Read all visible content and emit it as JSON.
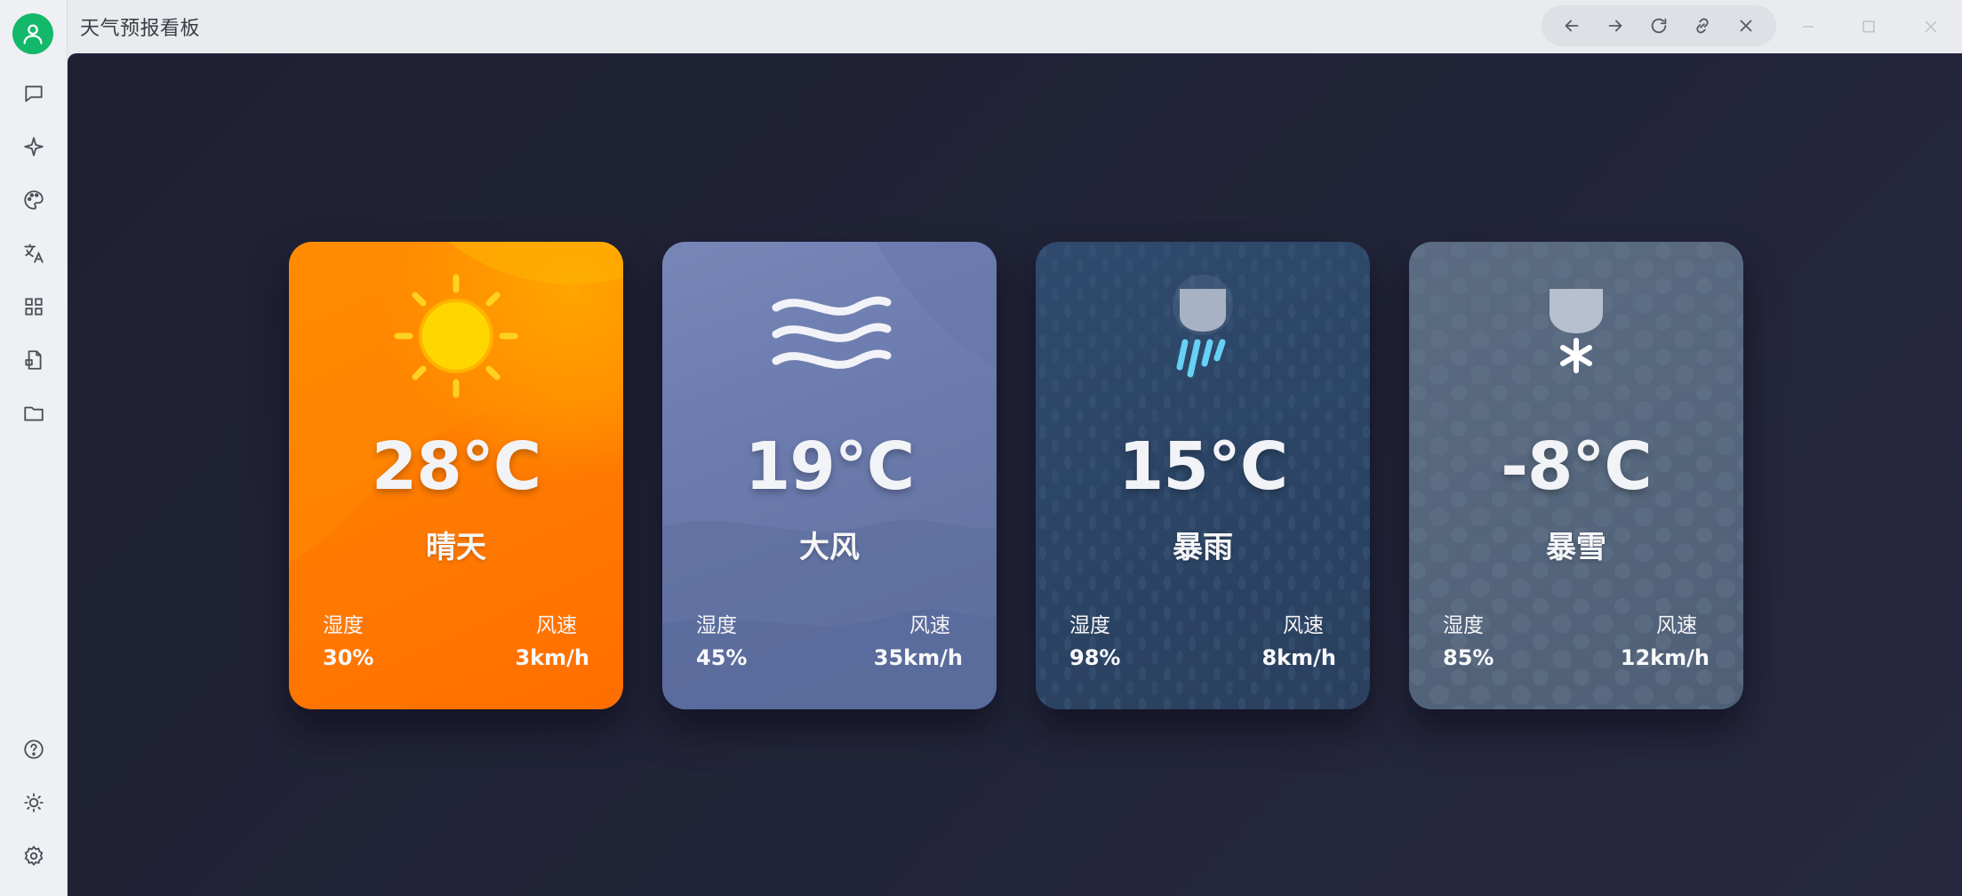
{
  "window": {
    "title": "天气预报看板"
  },
  "rail": {
    "items": [
      {
        "name": "chat-icon"
      },
      {
        "name": "sparkle-icon"
      },
      {
        "name": "palette-icon"
      },
      {
        "name": "translate-icon"
      },
      {
        "name": "apps-grid-icon"
      },
      {
        "name": "document-icon"
      },
      {
        "name": "folder-icon"
      },
      {
        "name": "help-icon"
      },
      {
        "name": "theme-toggle-icon"
      },
      {
        "name": "settings-icon"
      }
    ]
  },
  "nav": {
    "buttons": [
      "arrow-left-icon",
      "arrow-right-icon",
      "refresh-icon",
      "link-icon",
      "close-icon"
    ]
  },
  "cards": [
    {
      "temp": "28°C",
      "condition": "晴天",
      "humidity_label": "湿度",
      "humidity": "30%",
      "wind_label": "风速",
      "wind": "3km/h",
      "icon": "sun-icon",
      "color": "#ff7d00"
    },
    {
      "temp": "19°C",
      "condition": "大风",
      "humidity_label": "湿度",
      "humidity": "45%",
      "wind_label": "风速",
      "wind": "35km/h",
      "icon": "wind-icon",
      "color": "#6a7aac"
    },
    {
      "temp": "15°C",
      "condition": "暴雨",
      "humidity_label": "湿度",
      "humidity": "98%",
      "wind_label": "风速",
      "wind": "8km/h",
      "icon": "rain-cloud-icon",
      "color": "#2c4566"
    },
    {
      "temp": "-8°C",
      "condition": "暴雪",
      "humidity_label": "湿度",
      "humidity": "85%",
      "wind_label": "风速",
      "wind": "12km/h",
      "icon": "snow-cloud-icon",
      "color": "#55667d"
    }
  ]
}
